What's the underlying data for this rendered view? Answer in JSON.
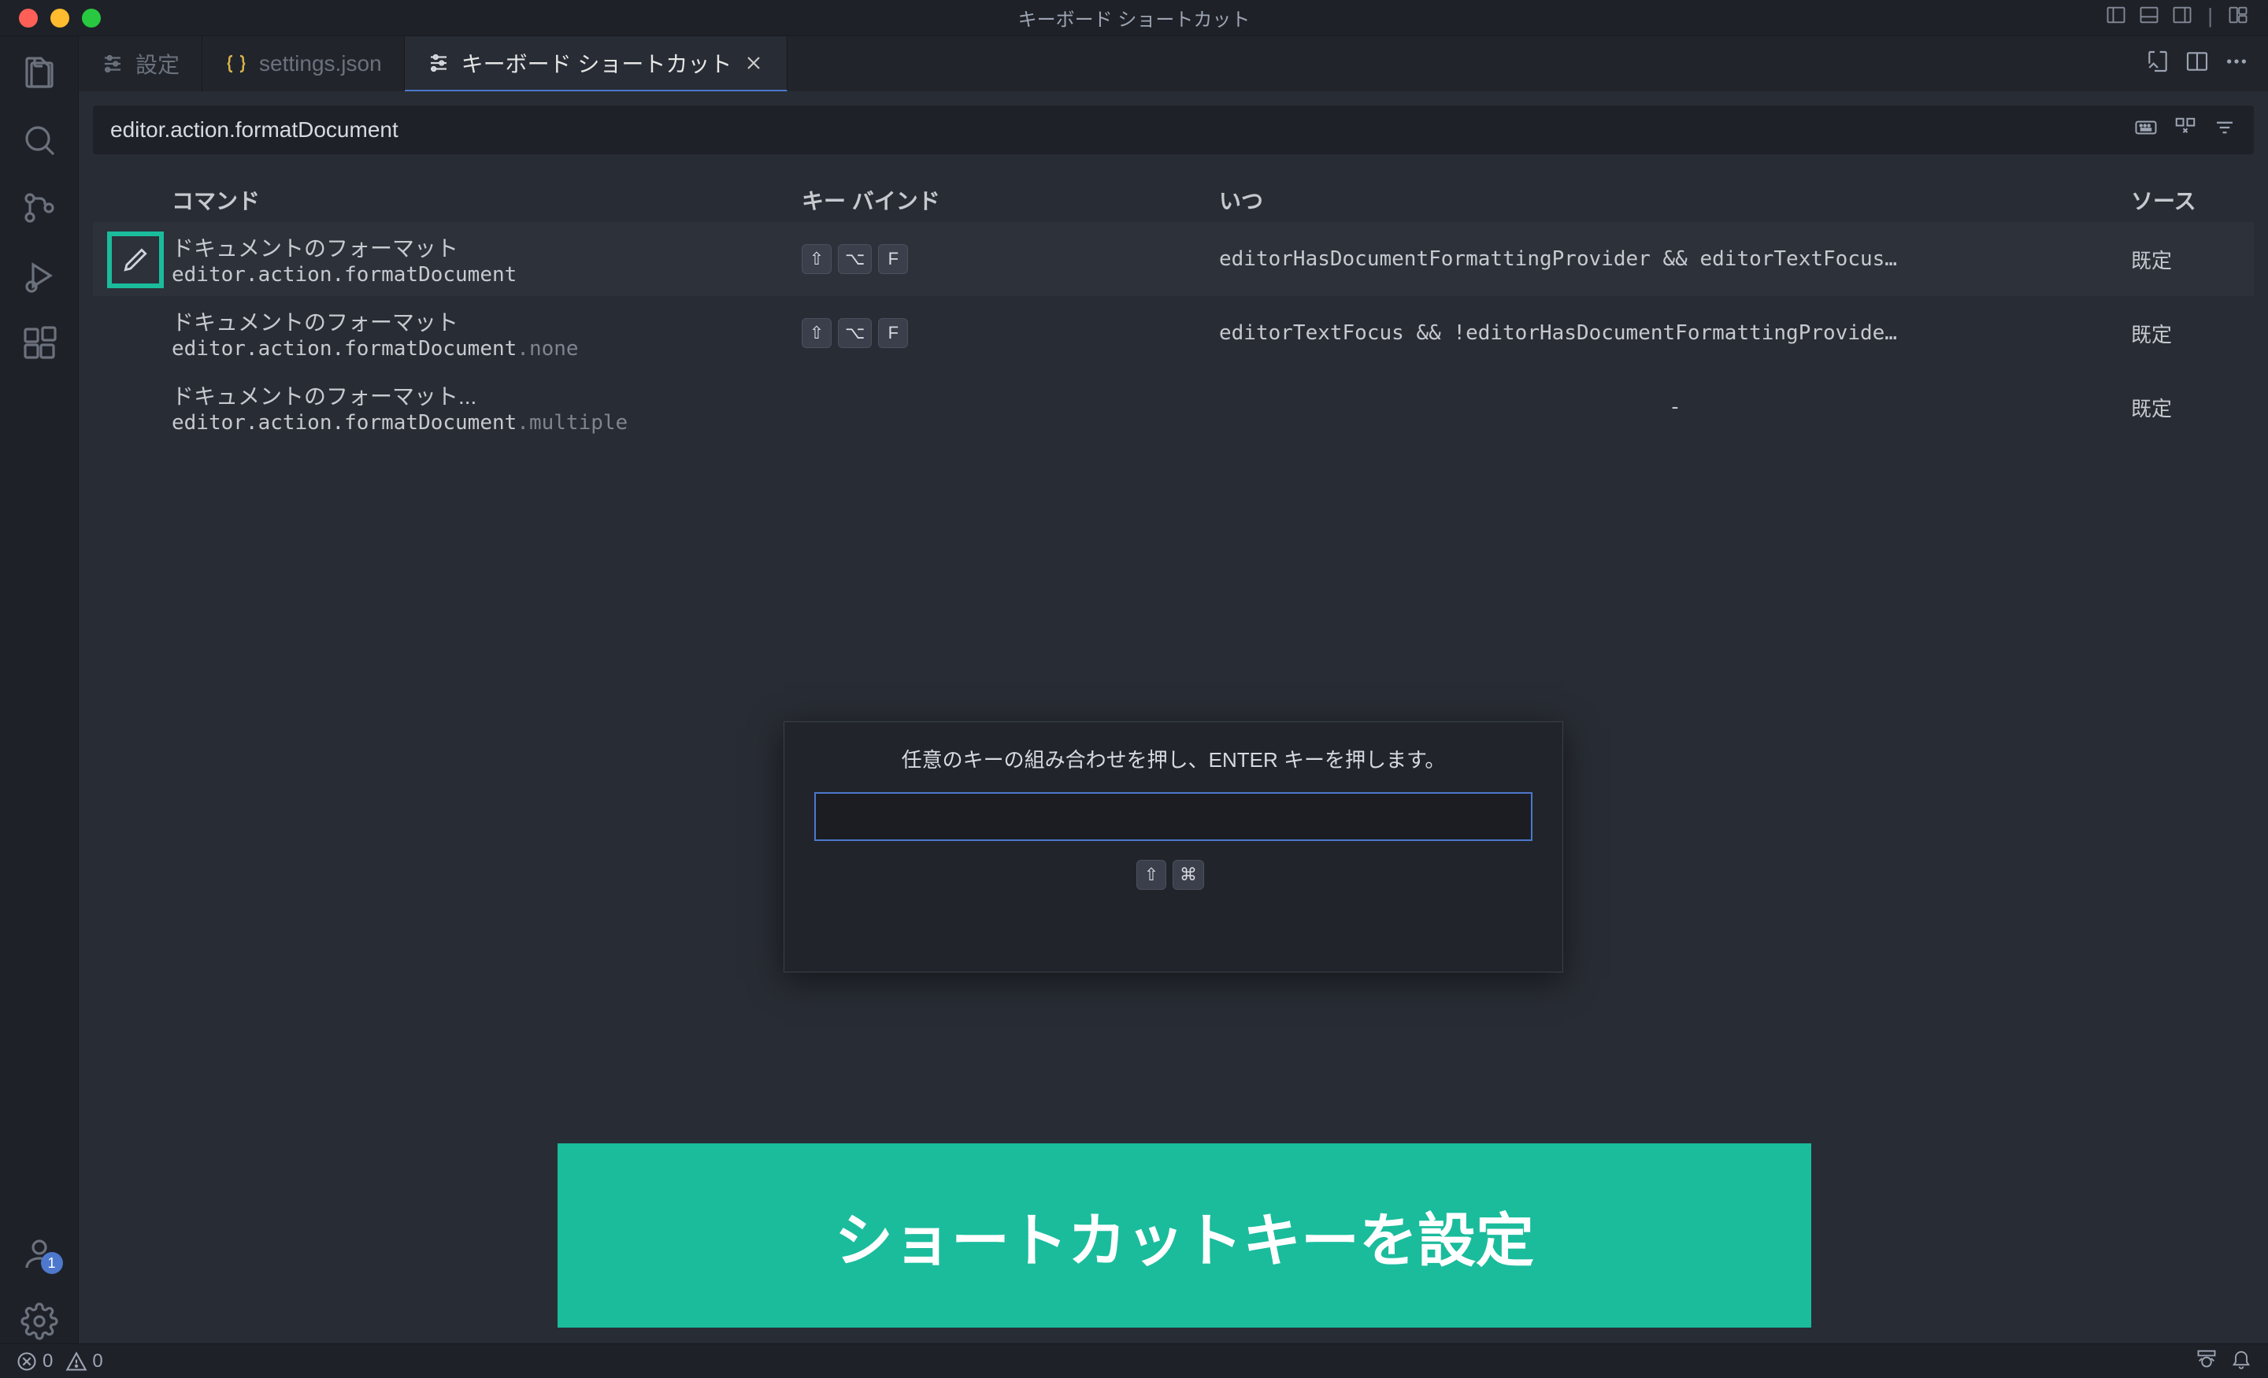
{
  "window": {
    "title": "キーボード ショートカット"
  },
  "tabs": [
    {
      "label": "設定",
      "active": false,
      "type": "settings"
    },
    {
      "label": "settings.json",
      "active": false,
      "type": "json"
    },
    {
      "label": "キーボード ショートカット",
      "active": true,
      "type": "settings"
    }
  ],
  "search": {
    "value": "editor.action.formatDocument"
  },
  "columns": {
    "command": "コマンド",
    "keybinding": "キー バインド",
    "when": "いつ",
    "source": "ソース"
  },
  "rows": [
    {
      "title": "ドキュメントのフォーマット",
      "id_main": "editor.action.formatDocument",
      "id_suffix": "",
      "keys": [
        "⇧",
        "⌥",
        "F"
      ],
      "when": "editorHasDocumentFormattingProvider && editorTextFocus…",
      "source": "既定",
      "selected": true,
      "editable": true
    },
    {
      "title": "ドキュメントのフォーマット",
      "id_main": "editor.action.formatDocument",
      "id_suffix": ".none",
      "keys": [
        "⇧",
        "⌥",
        "F"
      ],
      "when": "editorTextFocus && !editorHasDocumentFormattingProvide…",
      "source": "既定",
      "selected": false,
      "editable": false
    },
    {
      "title": "ドキュメントのフォーマット...",
      "id_main": "editor.action.formatDocument",
      "id_suffix": ".multiple",
      "keys": [],
      "when": "-",
      "source": "既定",
      "selected": false,
      "editable": false
    }
  ],
  "dialog": {
    "hint": "任意のキーの組み合わせを押し、ENTER キーを押します。",
    "keys": [
      "⇧",
      "⌘"
    ]
  },
  "annotation": {
    "text": "ショートカットキーを設定"
  },
  "statusbar": {
    "errors": "0",
    "warnings": "0"
  },
  "accounts_badge": "1"
}
